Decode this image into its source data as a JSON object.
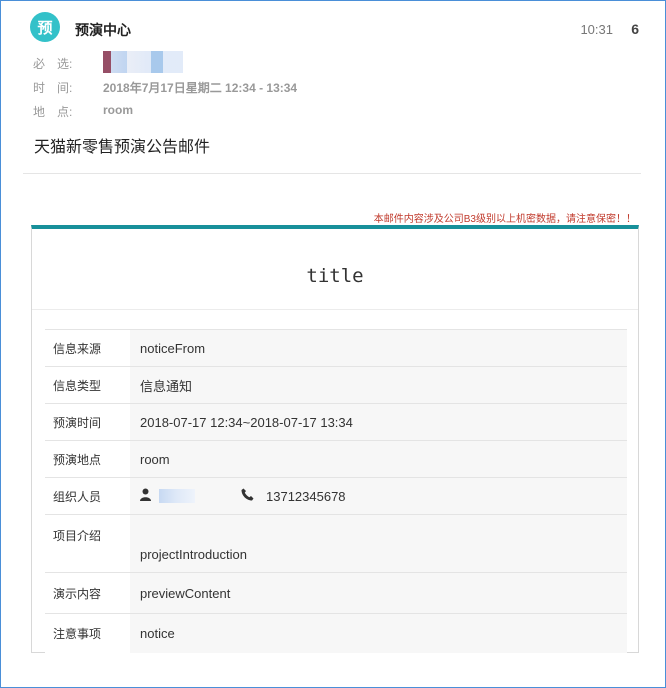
{
  "header": {
    "avatar_char": "预",
    "sender": "预演中心",
    "time": "10:31",
    "count": "6"
  },
  "meta": {
    "required_label": "必　选:",
    "time_label": "时　间:",
    "time_value": "2018年7月17日星期二 12:34 - 13:34",
    "location_label": "地　点:",
    "location_value": "room"
  },
  "subject": "天猫新零售预演公告邮件",
  "confidential_notice": "本邮件内容涉及公司B3级别以上机密数据，请注意保密！！",
  "card": {
    "title": "title",
    "rows": {
      "source_label": "信息来源",
      "source_value": "noticeFrom",
      "type_label": "信息类型",
      "type_value": "信息通知",
      "time_label": "预演时间",
      "time_value": "2018-07-17 12:34~2018-07-17 13:34",
      "place_label": "预演地点",
      "place_value": "room",
      "org_label": "组织人员",
      "org_phone": "13712345678",
      "intro_label": "项目介绍",
      "intro_value": "projectIntroduction",
      "content_label": "演示内容",
      "content_value": "previewContent",
      "notice_label": "注意事项",
      "notice_value": "notice"
    }
  },
  "colors": {
    "accent": "#17909a",
    "avatar": "#33c1c9",
    "warning": "#c0392b"
  }
}
